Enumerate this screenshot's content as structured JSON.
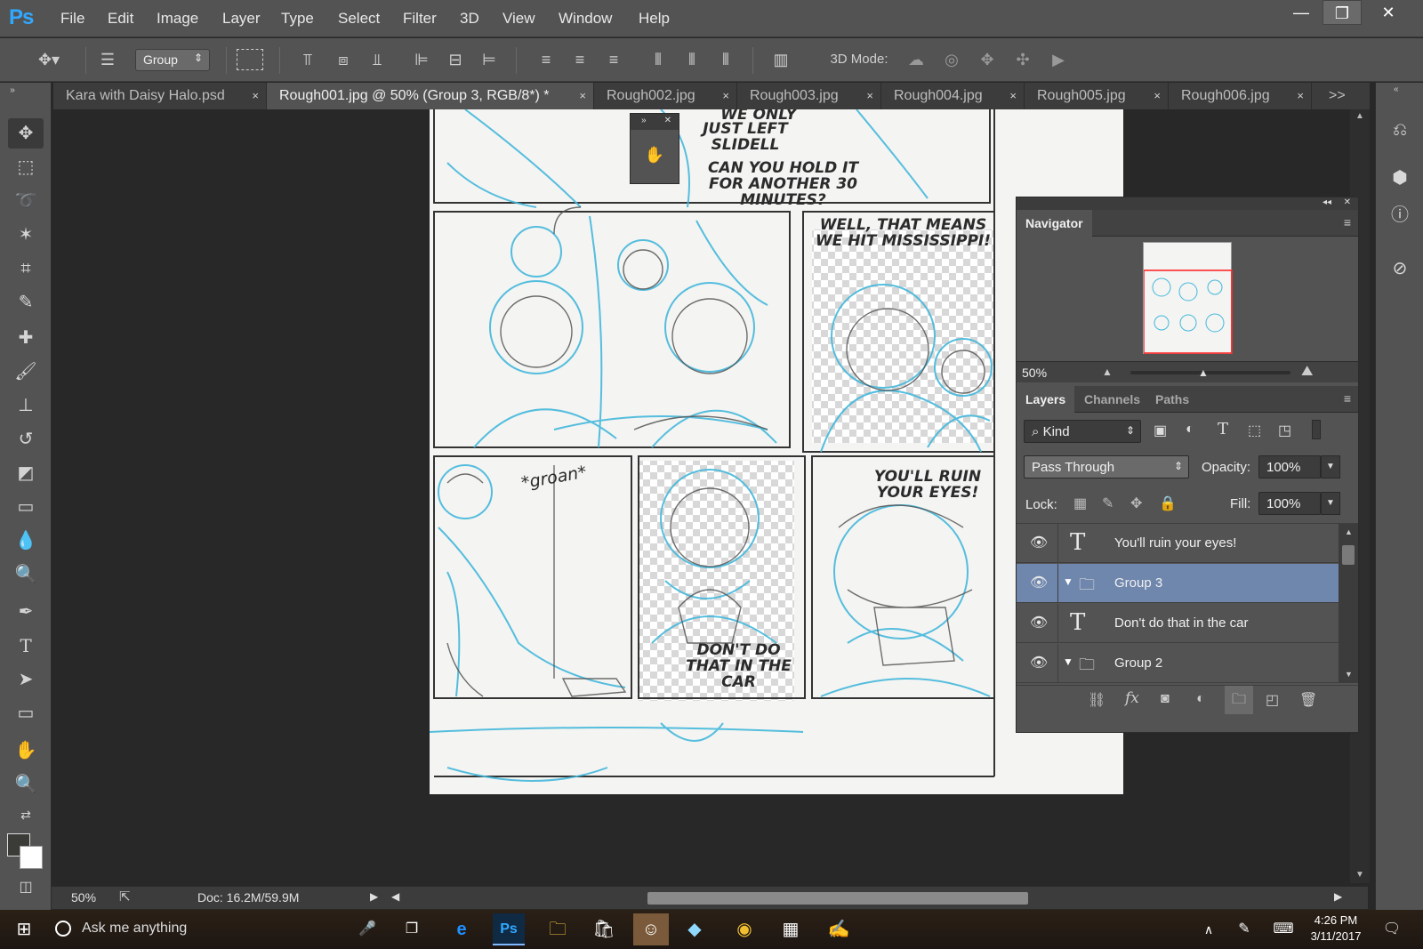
{
  "app": {
    "logo": "Ps",
    "accent": "#31a8ff"
  },
  "menu": [
    "File",
    "Edit",
    "Image",
    "Layer",
    "Type",
    "Select",
    "Filter",
    "3D",
    "View",
    "Window",
    "Help"
  ],
  "window_controls": {
    "minimize": "—",
    "restore": "❐",
    "close": "✕"
  },
  "options": {
    "auto_select_value": "Group",
    "mode_label": "3D Mode:"
  },
  "tabs": [
    {
      "label": "Kara with Daisy Halo.psd"
    },
    {
      "label": "Rough001.jpg @ 50% (Group 3, RGB/8*) *"
    },
    {
      "label": "Rough002.jpg"
    },
    {
      "label": "Rough003.jpg"
    },
    {
      "label": "Rough004.jpg"
    },
    {
      "label": "Rough005.jpg"
    },
    {
      "label": "Rough006.jpg"
    }
  ],
  "tab_close": "×",
  "tab_overflow": ">>",
  "comic": {
    "panel1_text": "JUST LEFT SLIDELL",
    "panel1_top": "WE ONLY",
    "panel1_question": "CAN YOU HOLD IT FOR ANOTHER 30 MINUTES?",
    "panel3_text": "WELL, THAT MEANS WE HIT MISSISSIPPI!",
    "panel4_sfx": "*groan*",
    "panel5_text": "DON'T DO THAT IN THE CAR",
    "panel6_text": "YOU'LL RUIN YOUR EYES!"
  },
  "navigator": {
    "title": "Navigator",
    "zoom": "50%"
  },
  "layers_panel": {
    "tabs": [
      "Layers",
      "Channels",
      "Paths"
    ],
    "filter_kind": "Kind",
    "blend_mode": "Pass Through",
    "opacity_label": "Opacity:",
    "opacity_value": "100%",
    "lock_label": "Lock:",
    "fill_label": "Fill:",
    "fill_value": "100%",
    "layers": [
      {
        "name": "You'll ruin your eyes!",
        "kind": "text",
        "selected": false
      },
      {
        "name": "Group 3",
        "kind": "group",
        "selected": true
      },
      {
        "name": "Don't do that in the car",
        "kind": "text",
        "selected": false
      },
      {
        "name": "Group 2",
        "kind": "group",
        "selected": false
      }
    ],
    "bottom_fx": "fx"
  },
  "status": {
    "zoom": "50%",
    "doc": "Doc: 16.2M/59.9M"
  },
  "taskbar": {
    "search_placeholder": "Ask me anything",
    "time": "4:26 PM",
    "date": "3/11/2017"
  }
}
